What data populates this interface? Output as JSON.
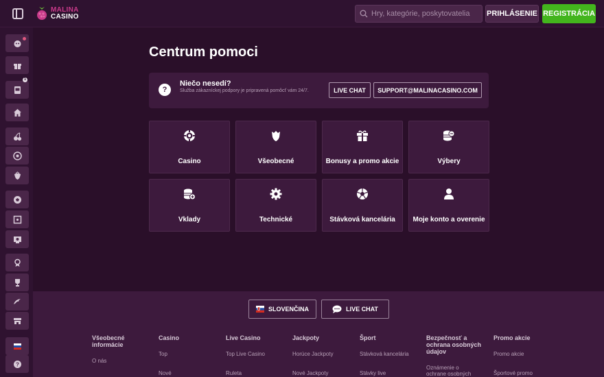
{
  "header": {
    "logo_line1": "MALINA",
    "logo_line2": "CASINO",
    "search_placeholder": "Hry, kategórie, poskytovatelia",
    "login_label": "PRIHLÁSENIE",
    "register_label": "REGISTRÁCIA"
  },
  "sidebar": {
    "items": [
      {
        "icon": "mascot-icon",
        "has_dot": true
      },
      {
        "icon": "gift-icon"
      },
      {
        "icon": "slot-machine-icon",
        "badge": "1"
      },
      {
        "icon": "home-icon"
      },
      {
        "icon": "cherries-icon"
      },
      {
        "icon": "roulette-icon"
      },
      {
        "icon": "strawberry-icon"
      },
      {
        "icon": "football-icon"
      },
      {
        "icon": "live-frame-icon"
      },
      {
        "icon": "virtual-sports-icon"
      },
      {
        "icon": "award-icon"
      },
      {
        "icon": "trophy-icon"
      },
      {
        "icon": "racing-icon"
      },
      {
        "icon": "store-icon"
      },
      {
        "icon": "slovak-flag-icon"
      },
      {
        "icon": "help-icon"
      }
    ]
  },
  "help": {
    "title": "Centrum pomoci",
    "banner_title": "Niečo nesedí?",
    "banner_desc": "Služba zákazníckej podpory je pripravená pomôcť vám 24/7.",
    "live_chat_label": "LIVE CHAT",
    "email_label": "SUPPORT@MALINACASINO.COM",
    "help_icon_glyph": "?"
  },
  "cards": [
    {
      "label": "Casino",
      "icon": "casino-chip-icon"
    },
    {
      "label": "Všeobecné",
      "icon": "shield-fruit-icon"
    },
    {
      "label": "Bonusy a promo akcie",
      "icon": "gift-icon"
    },
    {
      "label": "Výbery",
      "icon": "coins-withdraw-icon"
    },
    {
      "label": "Vklady",
      "icon": "coins-deposit-icon"
    },
    {
      "label": "Technické",
      "icon": "gear-icon"
    },
    {
      "label": "Stávková kancelária",
      "icon": "football-icon"
    },
    {
      "label": "Moje konto a overenie",
      "icon": "user-icon"
    }
  ],
  "footer": {
    "language_label": "SLOVENČINA",
    "chat_label": "LIVE CHAT",
    "columns": [
      {
        "title": "Všeobecné informácie",
        "links": [
          "O nás"
        ]
      },
      {
        "title": "Casino",
        "links": [
          "Top",
          "Nové"
        ]
      },
      {
        "title": "Live Casino",
        "links": [
          "Top Live Casino",
          "Ruleta"
        ]
      },
      {
        "title": "Jackpoty",
        "links": [
          "Horúce Jackpoty",
          "Nové Jackpoty"
        ]
      },
      {
        "title": "Šport",
        "links": [
          "Stávková kancelária",
          "Stávky live"
        ]
      },
      {
        "title": "Bezpečnosť a ochrana osobných údajov",
        "links": [
          "Oznámenie o ochrane osobných"
        ]
      },
      {
        "title": "Promo akcie",
        "links": [
          "Promo akcie",
          "Športové promo"
        ]
      }
    ]
  },
  "colors": {
    "background": "#2a0f29",
    "panel": "#3d1a3d",
    "register_green": "#43b51d",
    "brand_pink": "#c83a8a"
  }
}
